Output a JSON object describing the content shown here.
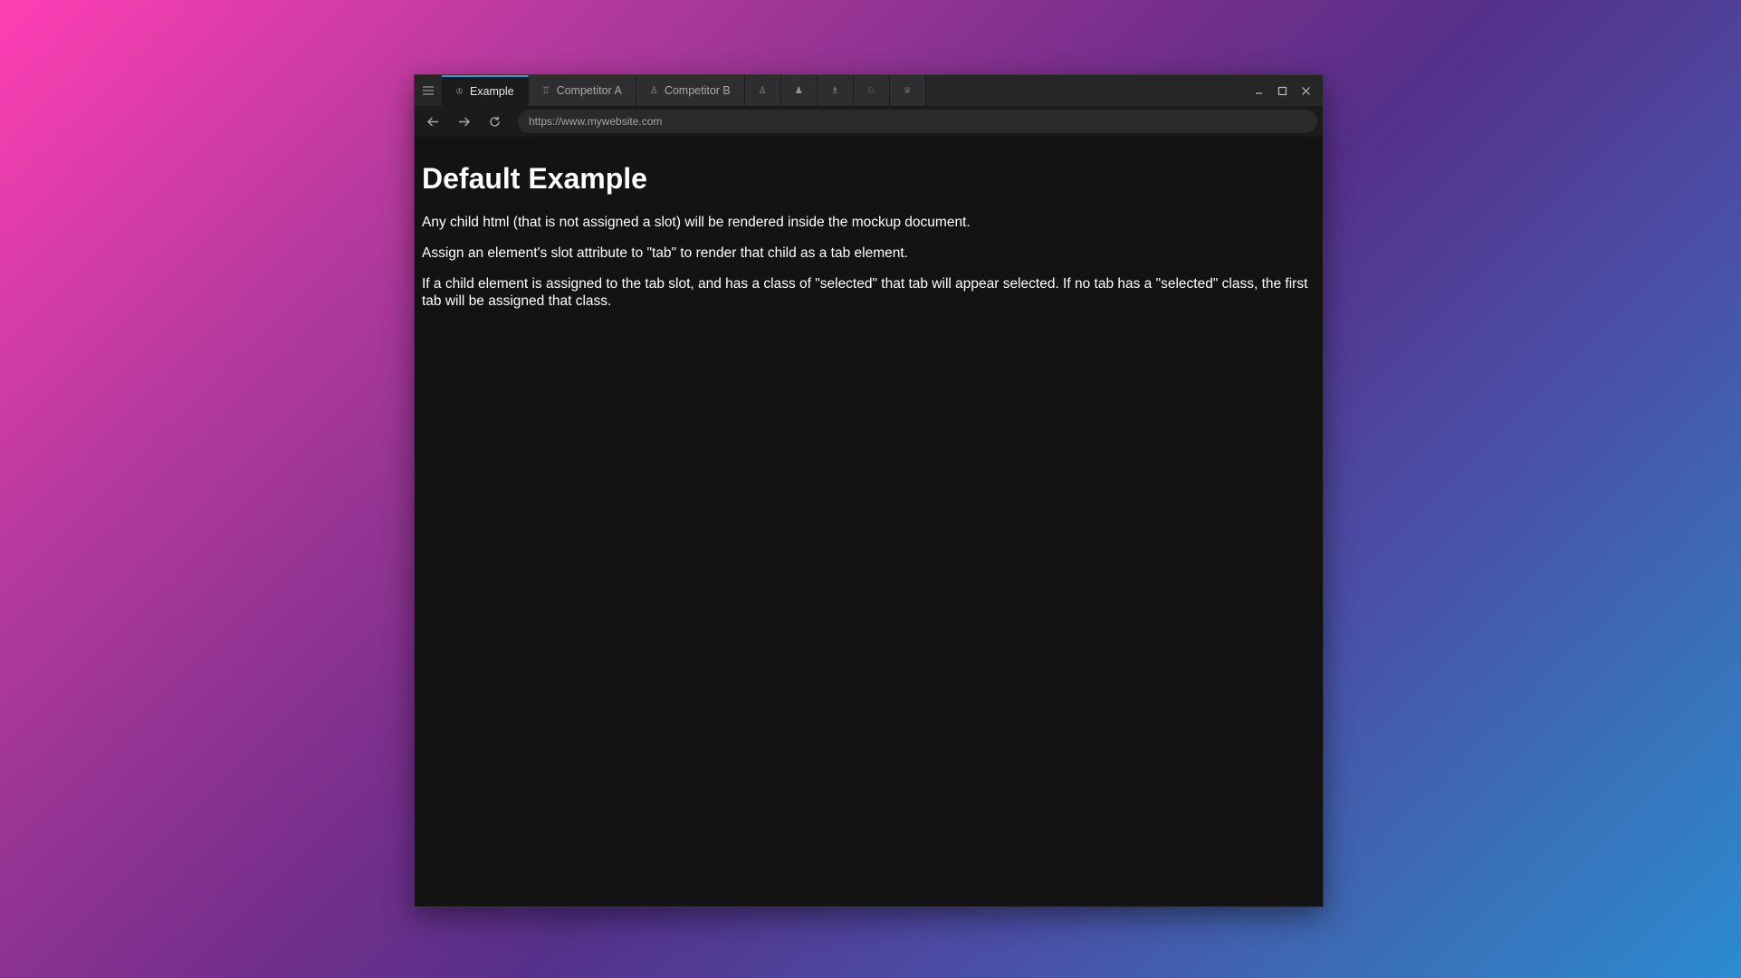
{
  "browser": {
    "menu_icon": "hamburger-menu-icon",
    "tabs": [
      {
        "label": "Example",
        "icon": "chess-king-icon",
        "selected": true
      },
      {
        "label": "Competitor A",
        "icon": "chess-rook-icon",
        "selected": false
      },
      {
        "label": "Competitor B",
        "icon": "chess-pawn-icon",
        "selected": false
      },
      {
        "label": "",
        "icon": "chess-pawn-outline-icon",
        "selected": false
      },
      {
        "label": "",
        "icon": "chess-pawn-filled-icon",
        "selected": false
      },
      {
        "label": "",
        "icon": "chess-bishop-icon",
        "selected": false
      },
      {
        "label": "",
        "icon": "chess-knight-icon",
        "selected": false
      },
      {
        "label": "",
        "icon": "chess-queen-icon",
        "selected": false
      }
    ],
    "window_controls": [
      "minimize-icon",
      "maximize-icon",
      "close-icon"
    ],
    "nav": {
      "back_icon": "arrow-left-icon",
      "forward_icon": "arrow-right-icon",
      "refresh_icon": "refresh-icon"
    },
    "url": "https://www.mywebsite.com"
  },
  "page": {
    "heading": "Default Example",
    "paragraphs": [
      "Any child html (that is not assigned a slot) will be rendered inside the mockup document.",
      "Assign an element's slot attribute to \"tab\" to render that child as a tab element.",
      "If a child element is assigned to the tab slot, and has a class of \"selected\" that tab will appear selected. If no tab has a \"selected\" class, the first tab will be assigned that class."
    ]
  },
  "colors": {
    "window_bg": "#131313",
    "tabbar_bg": "#262626",
    "tab_accent": "#3f8fc8",
    "text": "#ffffff"
  }
}
